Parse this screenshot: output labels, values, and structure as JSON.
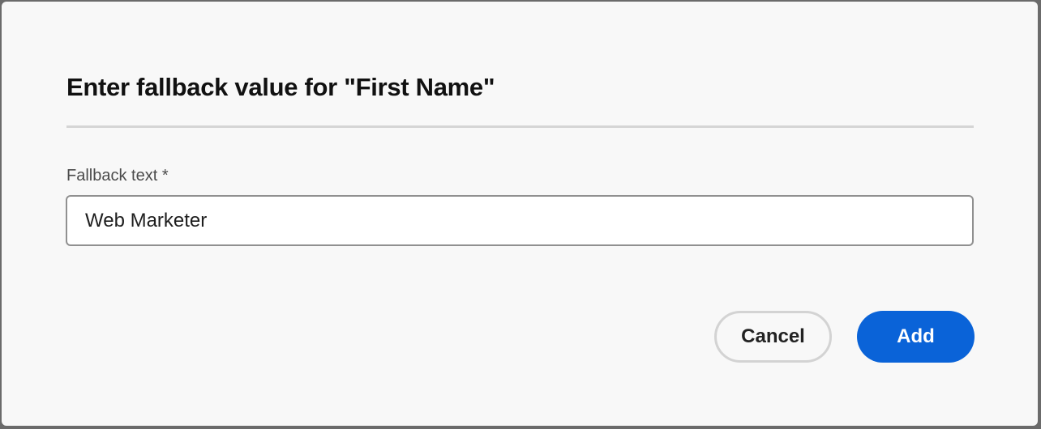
{
  "dialog": {
    "title": "Enter fallback value for \"First Name\"",
    "field": {
      "label": "Fallback text *",
      "value": "Web Marketer"
    },
    "buttons": {
      "cancel_label": "Cancel",
      "add_label": "Add"
    }
  },
  "colors": {
    "primary_button": "#0a63d8",
    "dialog_background": "#f8f8f8"
  }
}
